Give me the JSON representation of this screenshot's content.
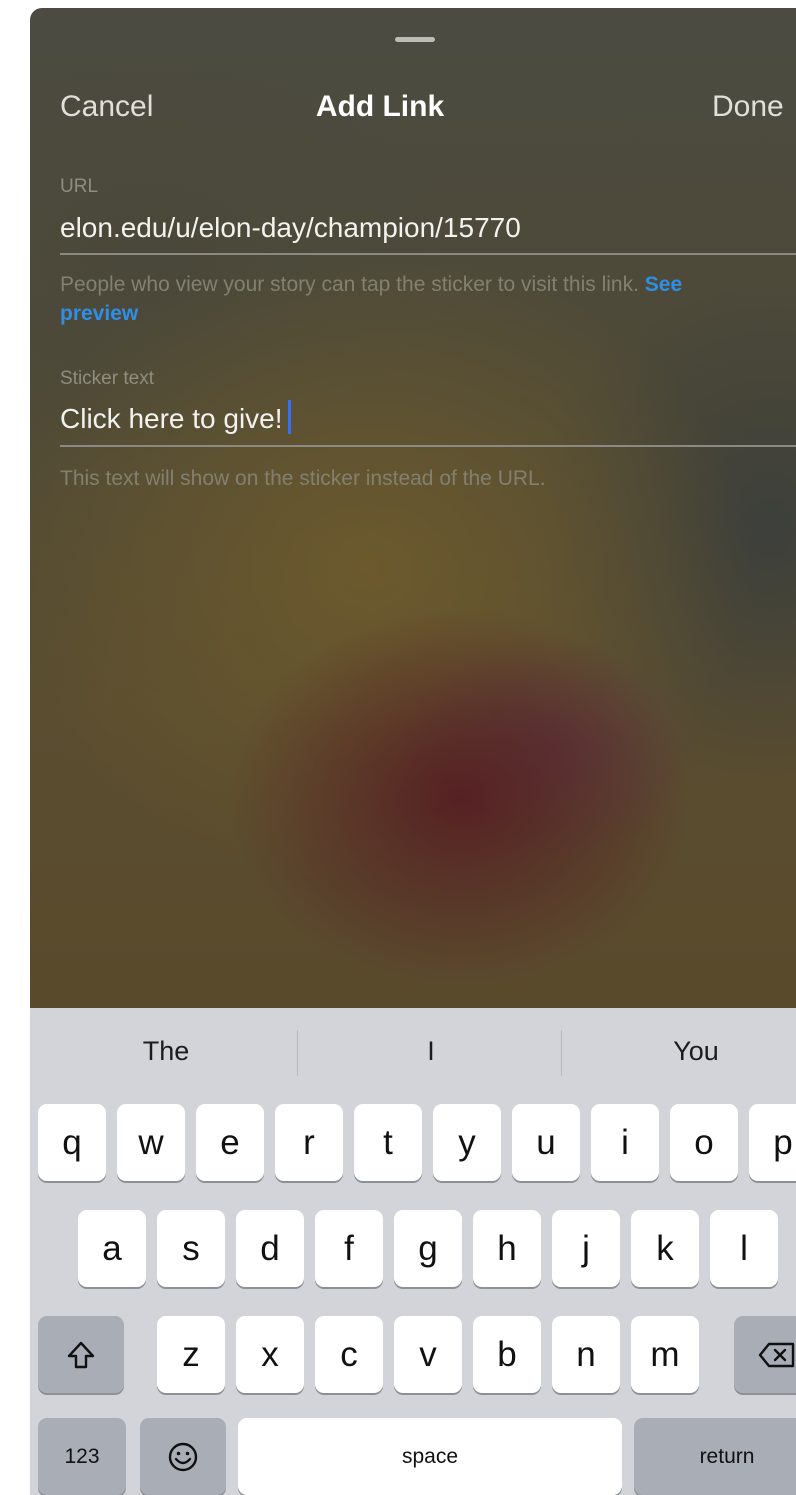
{
  "header": {
    "cancel_label": "Cancel",
    "title": "Add Link",
    "done_label": "Done"
  },
  "url_field": {
    "label": "URL",
    "value": "elon.edu/u/elon-day/champion/15770",
    "helper_text": "People who view your story can tap the sticker to visit this link.",
    "helper_link": "See preview"
  },
  "sticker_field": {
    "label": "Sticker text",
    "value": "Click here to give!",
    "helper_text": "This text will show on the sticker instead of the URL."
  },
  "keyboard": {
    "suggestions": [
      "The",
      "I",
      "You"
    ],
    "row1": [
      "q",
      "w",
      "e",
      "r",
      "t",
      "y",
      "u",
      "i",
      "o",
      "p"
    ],
    "row2": [
      "a",
      "s",
      "d",
      "f",
      "g",
      "h",
      "j",
      "k",
      "l"
    ],
    "row3": [
      "z",
      "x",
      "c",
      "v",
      "b",
      "n",
      "m"
    ],
    "shift_icon": "shift-icon",
    "delete_icon": "delete-icon",
    "numbers_label": "123",
    "emoji_icon": "emoji-icon",
    "space_label": "space",
    "return_label": "return"
  },
  "colors": {
    "link": "#2f8fe6",
    "cursor": "#3a6ff2",
    "keyboard_bg": "#d2d4da"
  }
}
